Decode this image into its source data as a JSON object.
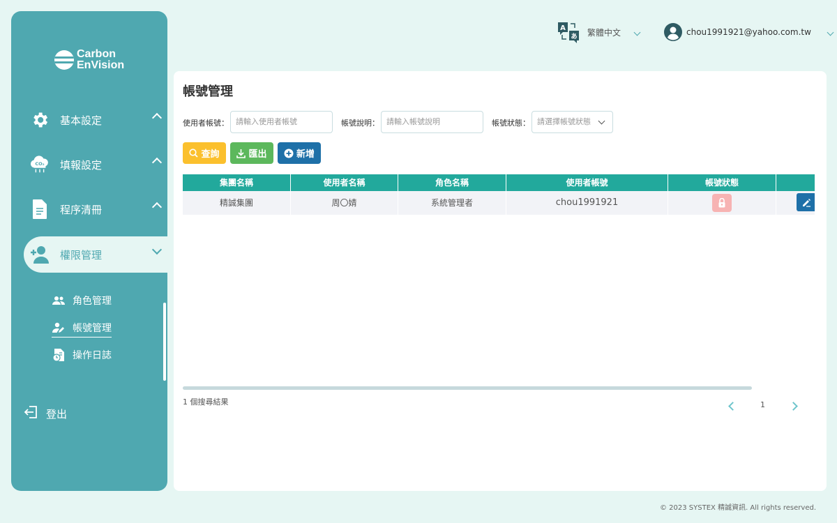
{
  "brand": {
    "line1": "Carbon",
    "line2": "EnVision"
  },
  "sidebar": {
    "items": [
      {
        "label": "基本設定",
        "icon": "gear-icon"
      },
      {
        "label": "填報設定",
        "icon": "co2-cloud-icon"
      },
      {
        "label": "程序清冊",
        "icon": "document-icon"
      },
      {
        "label": "權限管理",
        "icon": "add-user-icon"
      }
    ],
    "sub_items": [
      {
        "label": "角色管理",
        "icon": "users-icon"
      },
      {
        "label": "帳號管理",
        "icon": "user-edit-icon"
      },
      {
        "label": "操作日誌",
        "icon": "log-icon"
      }
    ],
    "logout": "登出"
  },
  "header": {
    "language": "繁體中文",
    "user_email": "chou1991921@yahoo.com.tw"
  },
  "page": {
    "title": "帳號管理",
    "filters": {
      "account_label": "使用者帳號：",
      "account_placeholder": "請輸入使用者帳號",
      "desc_label": "帳號說明：",
      "desc_placeholder": "請輸入帳號說明",
      "status_label": "帳號狀態：",
      "status_placeholder": "請選擇帳號狀態"
    },
    "buttons": {
      "query": "查詢",
      "export": "匯出",
      "add": "新增"
    },
    "colors": {
      "query": "#fbc02d",
      "export": "#5cb85c",
      "add": "#1e70a8",
      "header": "#22a99c"
    }
  },
  "table": {
    "headers": [
      "集團名稱",
      "使用者名稱",
      "角色名稱",
      "使用者帳號",
      "帳號狀態",
      ""
    ],
    "rows": [
      {
        "group": "精誠集團",
        "user_name": "周〇婧",
        "role": "系統管理者",
        "account": "chou1991921",
        "status": "locked"
      }
    ]
  },
  "pagination": {
    "result_text": "1 個搜尋結果",
    "current_page": "1"
  },
  "footer": "© 2023 SYSTEX 精誠資訊. All rights reserved."
}
